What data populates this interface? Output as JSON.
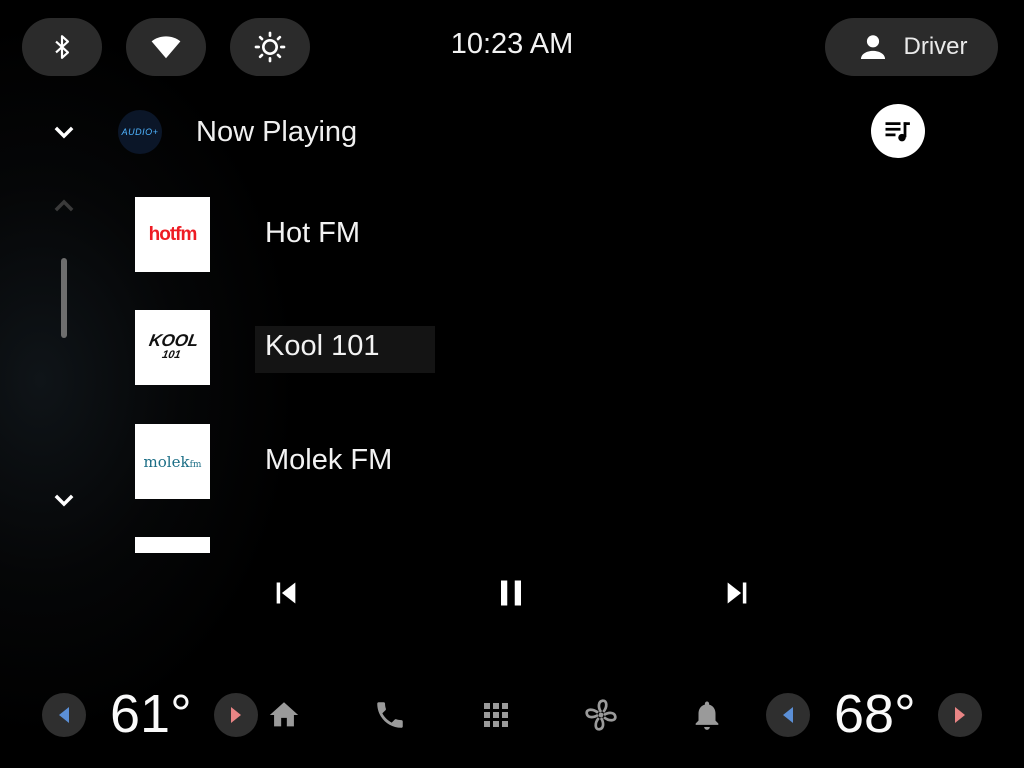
{
  "status_bar": {
    "time": "10:23 AM",
    "bluetooth_icon": "bluetooth-icon",
    "wifi_icon": "wifi-icon",
    "brightness_icon": "brightness-icon",
    "profile": {
      "icon": "person-icon",
      "label": "Driver"
    }
  },
  "header": {
    "collapse_icon": "chevron-down-icon",
    "source_logo_text": "AUDIO+",
    "title": "Now Playing",
    "queue_icon": "queue-music-icon"
  },
  "scroll": {
    "up_icon": "chevron-up-icon",
    "down_icon": "chevron-down-icon"
  },
  "stations": [
    {
      "label": "Hot FM",
      "logo_text": "hotfm"
    },
    {
      "label": "Kool 101",
      "logo_text": "KOOL",
      "logo_sub": "101"
    },
    {
      "label": "Molek FM",
      "logo_text": "molek",
      "logo_sub": "fm"
    }
  ],
  "transport": {
    "previous_icon": "skip-previous-icon",
    "pause_icon": "pause-icon",
    "next_icon": "skip-next-icon"
  },
  "bottom_bar": {
    "left_temp": "61°",
    "right_temp": "68°",
    "nav_icons": [
      "home-icon",
      "phone-icon",
      "apps-grid-icon",
      "fan-icon",
      "bell-icon"
    ]
  },
  "colors": {
    "background": "#000000",
    "pill": "#2b2b2b",
    "decrease_arrow": "#5b8fd6",
    "increase_arrow": "#e98585",
    "nav_icon": "#9a9a9a"
  }
}
